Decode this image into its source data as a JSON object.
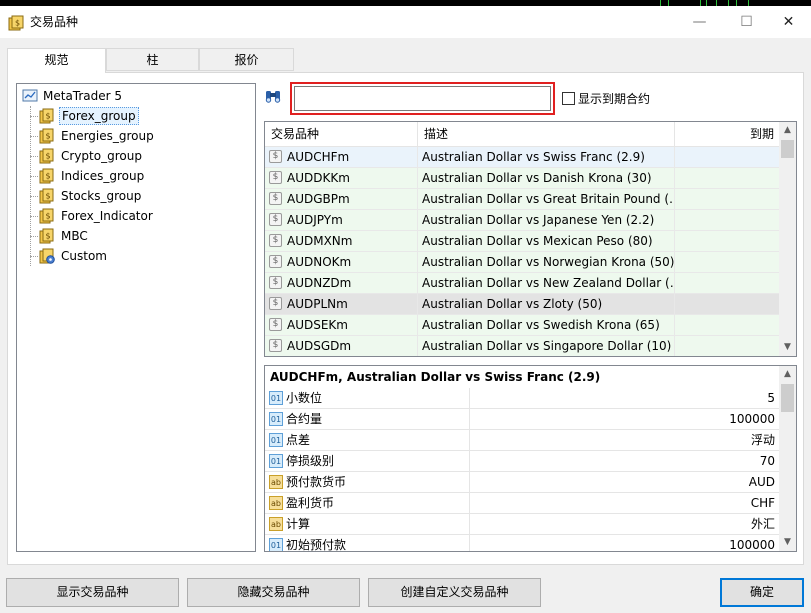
{
  "window": {
    "title": "交易品种",
    "controls": [
      "—",
      "☐",
      "✕"
    ]
  },
  "tabs": [
    {
      "label": "规范",
      "active": true
    },
    {
      "label": "柱",
      "active": false
    },
    {
      "label": "报价",
      "active": false
    }
  ],
  "tree": {
    "root": "MetaTrader 5",
    "items": [
      {
        "label": "Forex_group",
        "icon": "folder-dollar-icon",
        "selected": true
      },
      {
        "label": "Energies_group",
        "icon": "folder-dollar-icon"
      },
      {
        "label": "Crypto_group",
        "icon": "folder-dollar-icon"
      },
      {
        "label": "Indices_group",
        "icon": "folder-dollar-icon"
      },
      {
        "label": "Stocks_group",
        "icon": "folder-dollar-icon"
      },
      {
        "label": "Forex_Indicator",
        "icon": "folder-dollar-icon"
      },
      {
        "label": "MBC",
        "icon": "folder-dollar-icon"
      },
      {
        "label": "Custom",
        "icon": "folder-gear-icon"
      }
    ]
  },
  "search": {
    "value": "",
    "placeholder": "",
    "show_expired_label": "显示到期合约",
    "show_expired_checked": false
  },
  "symbols_table": {
    "columns": [
      "交易品种",
      "描述",
      "到期"
    ],
    "rows": [
      {
        "symbol": "AUDCHFm",
        "description": "Australian Dollar vs Swiss Franc (2.9)",
        "expiry": "",
        "selected": true
      },
      {
        "symbol": "AUDDKKm",
        "description": "Australian Dollar vs Danish Krona (30)",
        "expiry": ""
      },
      {
        "symbol": "AUDGBPm",
        "description": "Australian Dollar vs Great Britain Pound (…",
        "expiry": ""
      },
      {
        "symbol": "AUDJPYm",
        "description": "Australian Dollar vs Japanese Yen (2.2)",
        "expiry": ""
      },
      {
        "symbol": "AUDMXNm",
        "description": "Australian Dollar vs Mexican Peso (80)",
        "expiry": ""
      },
      {
        "symbol": "AUDNOKm",
        "description": "Australian Dollar vs Norwegian Krona (50)",
        "expiry": ""
      },
      {
        "symbol": "AUDNZDm",
        "description": "Australian Dollar vs New Zealand Dollar (…",
        "expiry": ""
      },
      {
        "symbol": "AUDPLNm",
        "description": "Australian Dollar vs Zloty (50)",
        "expiry": ""
      },
      {
        "symbol": "AUDSEKm",
        "description": "Australian Dollar vs Swedish Krona (65)",
        "expiry": ""
      },
      {
        "symbol": "AUDSGDm",
        "description": "Australian Dollar vs Singapore Dollar (10)",
        "expiry": ""
      }
    ]
  },
  "properties": {
    "title": "AUDCHFm, Australian Dollar vs Swiss Franc (2.9)",
    "rows": [
      {
        "key": "小数位",
        "value": "5",
        "type": "number",
        "icon_text": "01"
      },
      {
        "key": "合约量",
        "value": "100000",
        "type": "number",
        "icon_text": "01"
      },
      {
        "key": "点差",
        "value": "浮动",
        "type": "number",
        "icon_text": "01"
      },
      {
        "key": "停损级别",
        "value": "70",
        "type": "number",
        "icon_text": "01"
      },
      {
        "key": "预付款货币",
        "value": "AUD",
        "type": "string",
        "icon_text": "ab"
      },
      {
        "key": "盈利货币",
        "value": "CHF",
        "type": "string",
        "icon_text": "ab"
      },
      {
        "key": "计算",
        "value": "外汇",
        "type": "string",
        "icon_text": "ab"
      },
      {
        "key": "初始预付款",
        "value": "100000",
        "type": "number",
        "icon_text": "01"
      }
    ]
  },
  "buttons": {
    "show": "显示交易品种",
    "hide": "隐藏交易品种",
    "create": "创建自定义交易品种",
    "ok": "确定"
  },
  "colors": {
    "row_green": "#eef9ee",
    "row_selected": "#e3e3e3",
    "row_first": "#eaf3fb",
    "search_highlight": "#e02020",
    "default_button_border": "#0078d7"
  }
}
